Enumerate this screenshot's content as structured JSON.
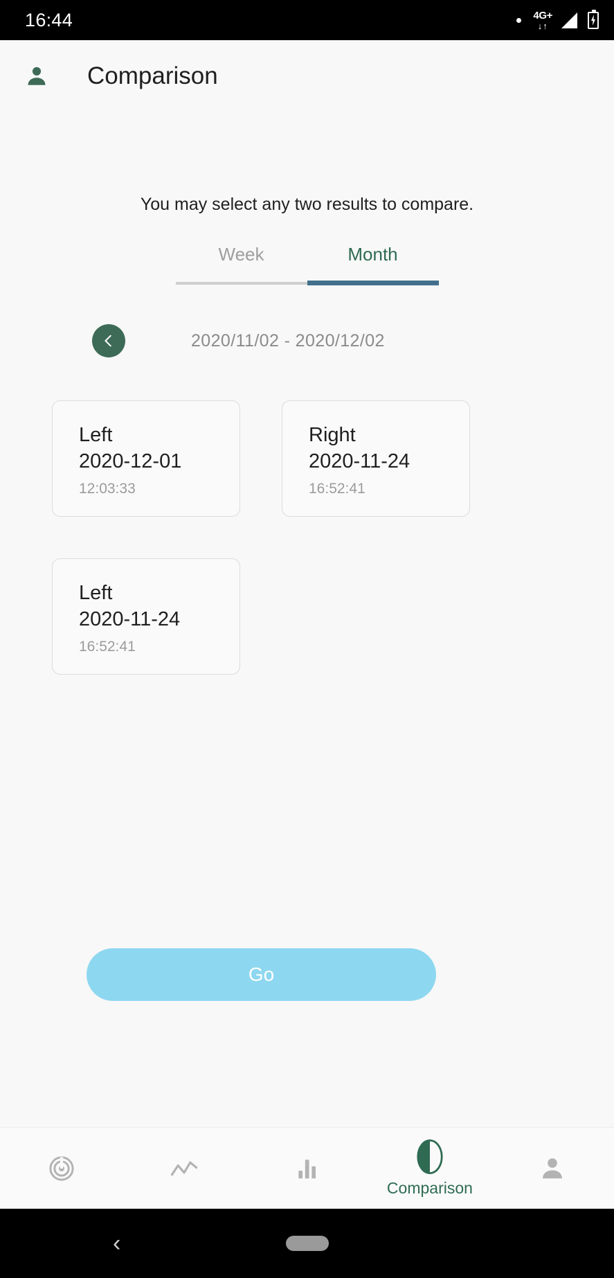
{
  "status_bar": {
    "time": "16:44",
    "dot_icon": "dot-icon",
    "network_gen": "4G+",
    "network_arrows": "↓↑",
    "signal_icon": "signal-icon",
    "battery_icon": "battery-charging-icon"
  },
  "header": {
    "avatar_icon": "person-icon",
    "title": "Comparison"
  },
  "main": {
    "hint": "You may select any two results to compare.",
    "tabs": [
      {
        "label": "Week",
        "active": false
      },
      {
        "label": "Month",
        "active": true
      }
    ],
    "date_nav": {
      "prev_icon": "chevron-left-icon",
      "range": "2020/11/02 - 2020/12/02"
    },
    "results": [
      {
        "side": "Left",
        "date": "2020-12-01",
        "time": "12:03:33"
      },
      {
        "side": "Right",
        "date": "2020-11-24",
        "time": "16:52:41"
      },
      {
        "side": "Left",
        "date": "2020-11-24",
        "time": "16:52:41"
      }
    ],
    "go_label": "Go"
  },
  "bottom_nav": [
    {
      "icon": "radar-measure-icon",
      "label": ""
    },
    {
      "icon": "line-chart-icon",
      "label": ""
    },
    {
      "icon": "bar-chart-icon",
      "label": ""
    },
    {
      "icon": "half-circle-comparison-icon",
      "label": "Comparison"
    },
    {
      "icon": "person-icon",
      "label": ""
    }
  ],
  "android_nav": {
    "back_icon": "‹",
    "home_icon": "home-pill-icon"
  },
  "colors": {
    "brand_green": "#3d6b57",
    "active_tab_underline": "#42708c",
    "go_button": "#8ed7f0",
    "inactive_gray": "#9e9e9e"
  }
}
